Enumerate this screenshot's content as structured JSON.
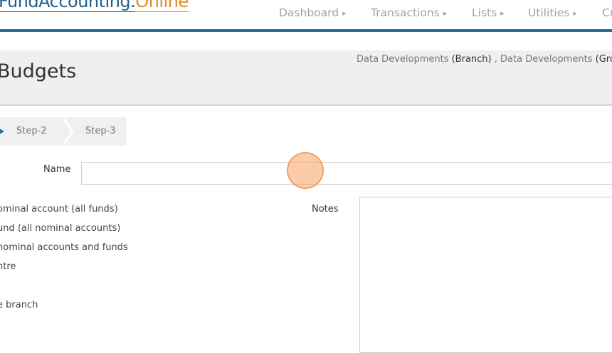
{
  "app": {
    "logo_part1": "FundAccounting.",
    "logo_part2": "Online"
  },
  "nav": {
    "items": [
      {
        "label": "Dashboard"
      },
      {
        "label": "Transactions"
      },
      {
        "label": "Lists"
      },
      {
        "label": "Utilities"
      },
      {
        "label": "Cr"
      }
    ]
  },
  "page": {
    "title": "Budgets",
    "org": {
      "branch_name": "Data Developments",
      "branch_tag": "(Branch)",
      "separator": " , ",
      "group_name": "Data Developments",
      "group_tag": "(Group"
    }
  },
  "steps": {
    "items": [
      {
        "label": "Step-2"
      },
      {
        "label": "Step-3"
      }
    ]
  },
  "form": {
    "name_label": "Name",
    "name_value": "",
    "notes_label": "Notes",
    "notes_value": "",
    "options": [
      "ominal account (all funds)",
      "und (all nominal accounts)",
      "nominal accounts and funds",
      "ntre",
      "",
      "e branch"
    ]
  },
  "colors": {
    "brand_blue": "#2d6e98",
    "brand_orange": "#e28a2b",
    "nav_text": "#9aa4ad",
    "header_band": "#efefef",
    "cursor_highlight": "#f7a064"
  }
}
